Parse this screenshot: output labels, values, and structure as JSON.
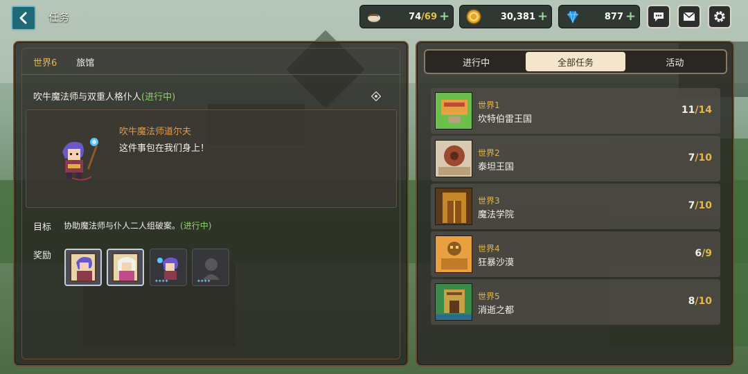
{
  "header": {
    "title": "任务",
    "resources": {
      "stamina": {
        "current": "74",
        "max": "69",
        "icon": "coffee-cup-icon"
      },
      "gold": {
        "value": "30,381",
        "icon": "gold-coin-icon"
      },
      "gems": {
        "value": "877",
        "icon": "gem-icon"
      }
    },
    "plus": "+",
    "stamina_sep": "/"
  },
  "quest": {
    "world": "世界6",
    "location": "旅馆",
    "title": "吹牛魔法师与双重人格仆人",
    "status": "(进行中)",
    "speaker": "吹牛魔法师道尔夫",
    "speech": "这件事包在我们身上！",
    "goal_label": "目标",
    "goal_text": "协助魔法师与仆人二人组破案。",
    "goal_status": "(进行中)",
    "reward_label": "奖励"
  },
  "tabs": [
    "进行中",
    "全部任务",
    "活动"
  ],
  "active_tab": 1,
  "worlds": [
    {
      "num": "世界1",
      "name": "坎特伯雷王国",
      "done": "11",
      "total": "14"
    },
    {
      "num": "世界2",
      "name": "泰坦王国",
      "done": "7",
      "total": "10"
    },
    {
      "num": "世界3",
      "name": "魔法学院",
      "done": "7",
      "total": "10"
    },
    {
      "num": "世界4",
      "name": "狂暴沙漠",
      "done": "6",
      "total": "9"
    },
    {
      "num": "世界5",
      "name": "消逝之都",
      "done": "8",
      "total": "10"
    }
  ],
  "colors": {
    "accent_gold": "#e6b64b",
    "status_green": "#8fd36b",
    "speaker_orange": "#e49a4a",
    "tab_active": "#f4e6cc",
    "panel_border": "#6a4d2e"
  }
}
